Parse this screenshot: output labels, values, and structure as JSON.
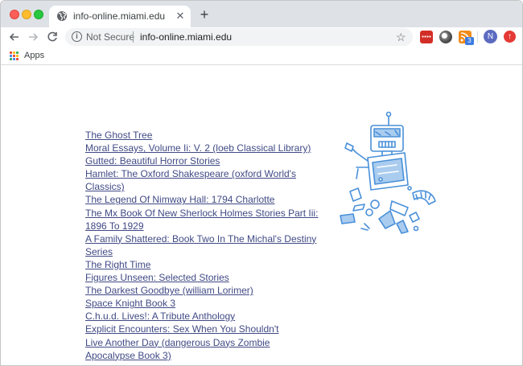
{
  "browser": {
    "tab_title": "info-online.miami.edu",
    "tab_close": "✕",
    "new_tab": "+",
    "security_label": "Not Secure",
    "url": "info-online.miami.edu",
    "profile_initial": "N",
    "rss_badge_count": "3",
    "bookmarks_apps_label": "Apps"
  },
  "icons": {
    "back": "arrow-left",
    "forward": "arrow-right",
    "reload": "reload",
    "info": "info",
    "bookmark_star": "star",
    "extensions": [
      "lastpass",
      "shade",
      "rss-feed",
      "update"
    ]
  },
  "colors": {
    "tabstrip": "#dee1e6",
    "link": "#414a85",
    "robot_stroke": "#4a90d9",
    "robot_fill": "#a9ccef"
  },
  "books": [
    "The Ghost Tree",
    "Moral Essays, Volume Ii: V. 2 (loeb Classical Library)",
    "Gutted: Beautiful Horror Stories",
    "Hamlet: The Oxford Shakespeare (oxford World's Classics)",
    "The Legend Of Nimway Hall: 1794 Charlotte",
    "The Mx Book Of New Sherlock Holmes Stories Part Iii: 1896 To 1929",
    "A Family Shattered: Book Two In The Michal's Destiny Series",
    "The Right Time",
    "Figures Unseen: Selected Stories",
    "The Darkest Goodbye (william Lorimer)",
    "Space Knight Book 3",
    "C.h.u.d. Lives!: A Tribute Anthology",
    "Explicit Encounters: Sex When You Shouldn't",
    "Live Another Day (dangerous Days Zombie Apocalypse Book 3)"
  ]
}
